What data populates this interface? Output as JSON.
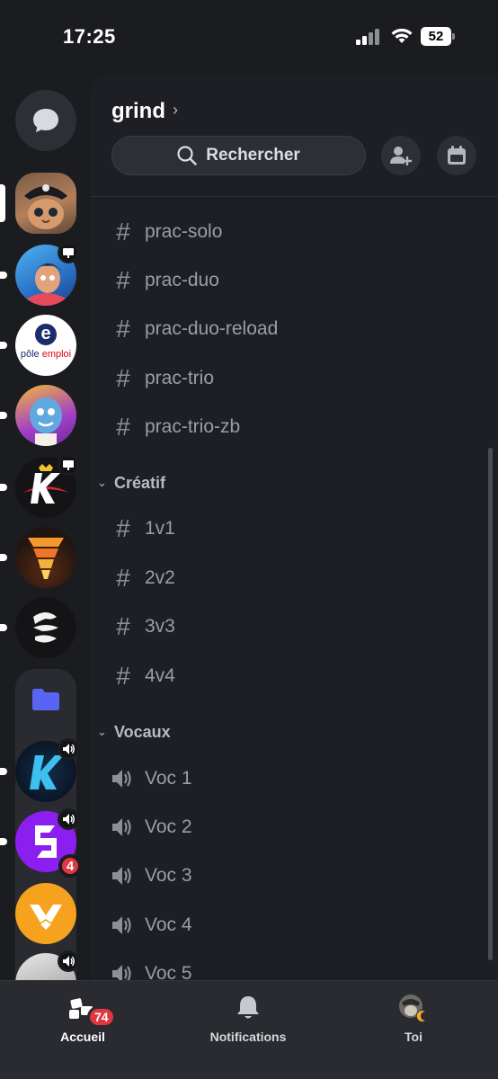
{
  "status_bar": {
    "time": "17:25",
    "battery": "52"
  },
  "server": {
    "name": "grind",
    "search_label": "Rechercher"
  },
  "channels_top": [
    {
      "name": "prac-solo"
    },
    {
      "name": "prac-duo"
    },
    {
      "name": "prac-duo-reload"
    },
    {
      "name": "prac-trio"
    },
    {
      "name": "prac-trio-zb"
    }
  ],
  "categories": [
    {
      "name": "Créatif"
    },
    {
      "name": "Vocaux"
    }
  ],
  "creative_channels": [
    {
      "name": "1v1"
    },
    {
      "name": "2v2"
    },
    {
      "name": "3v3"
    },
    {
      "name": "4v4"
    }
  ],
  "voice_channels": [
    {
      "name": "Voc 1"
    },
    {
      "name": "Voc 2"
    },
    {
      "name": "Voc 3"
    },
    {
      "name": "Voc 4"
    },
    {
      "name": "Voc 5"
    }
  ],
  "rail": {
    "pole_emploi_text_a": "pôle",
    "pole_emploi_text_b": "emploi",
    "pole_emploi_letter": "e",
    "unread_badge": "4"
  },
  "bottom_nav": {
    "home_label": "Accueil",
    "home_badge": "74",
    "notifications_label": "Notifications",
    "profile_label": "Toi"
  },
  "colors": {
    "background": "#1b1c20",
    "panel": "#1e1f24",
    "badge_red": "#e0383e",
    "folder_blue": "#5865f2"
  }
}
